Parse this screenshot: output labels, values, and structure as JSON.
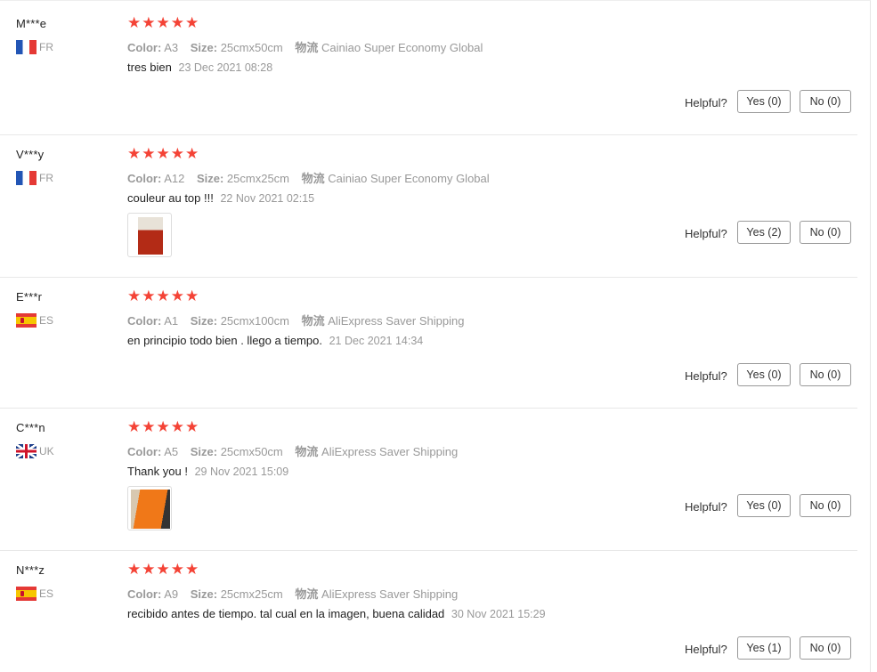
{
  "labels": {
    "color": "Color:",
    "size": "Size:",
    "shipping": "物流",
    "helpful": "Helpful?"
  },
  "stars_text": "★★★★★",
  "colors": {
    "star": "#f44336",
    "muted": "#999999"
  },
  "reviews": [
    {
      "name": "M***e",
      "country": "FR",
      "flag": "flag-fr",
      "rating": 5,
      "color": "A3",
      "size": "25cmx50cm",
      "shipping": "Cainiao Super Economy Global",
      "comment": "tres bien",
      "date": "23 Dec 2021 08:28",
      "yes": "Yes (0)",
      "no": "No (0)"
    },
    {
      "name": "V***y",
      "country": "FR",
      "flag": "flag-fr",
      "rating": 5,
      "color": "A12",
      "size": "25cmx25cm",
      "shipping": "Cainiao Super Economy Global",
      "comment": "couleur au top !!!",
      "date": "22 Nov 2021 02:15",
      "yes": "Yes (2)",
      "no": "No (0)"
    },
    {
      "name": "E***r",
      "country": "ES",
      "flag": "flag-es",
      "rating": 5,
      "color": "A1",
      "size": "25cmx100cm",
      "shipping": "AliExpress Saver Shipping",
      "comment": "en principio todo bien . llego a tiempo.",
      "date": "21 Dec 2021 14:34",
      "yes": "Yes (0)",
      "no": "No (0)"
    },
    {
      "name": "C***n",
      "country": "UK",
      "flag": "flag-uk",
      "rating": 5,
      "color": "A5",
      "size": "25cmx50cm",
      "shipping": "AliExpress Saver Shipping",
      "comment": "Thank you !",
      "date": "29 Nov 2021 15:09",
      "yes": "Yes (0)",
      "no": "No (0)"
    },
    {
      "name": "N***z",
      "country": "ES",
      "flag": "flag-es",
      "rating": 5,
      "color": "A9",
      "size": "25cmx25cm",
      "shipping": "AliExpress Saver Shipping",
      "comment": "recibido antes de tiempo. tal cual en la imagen, buena calidad",
      "date": "30 Nov 2021 15:29",
      "yes": "Yes (1)",
      "no": "No (0)"
    }
  ]
}
